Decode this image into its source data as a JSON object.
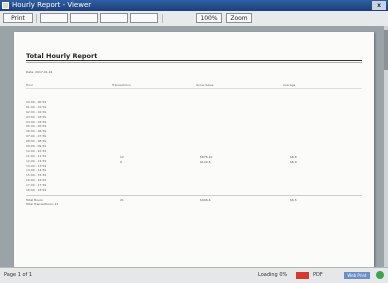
{
  "window": {
    "title": "Hourly Report - Viewer",
    "close_label": "x"
  },
  "toolbar": {
    "buttons": [
      {
        "label": "Print"
      },
      {
        "label": ""
      },
      {
        "label": ""
      },
      {
        "label": ""
      },
      {
        "label": ""
      },
      {
        "label": "100%"
      },
      {
        "label": "Zoom"
      }
    ]
  },
  "report": {
    "title": "Total Hourly Report",
    "subtitle": "Date: 2017-01-01",
    "columns": [
      "Hour",
      "Transactions",
      "Gross Sales",
      "Average"
    ],
    "hours": [
      "00:00 - 00:59",
      "01:00 - 01:59",
      "02:00 - 02:59",
      "03:00 - 03:59",
      "04:00 - 04:59",
      "05:00 - 05:59",
      "06:00 - 06:59",
      "07:00 - 07:59",
      "08:00 - 08:59",
      "09:00 - 09:59",
      "10:00 - 10:59",
      "11:00 - 11:59",
      "12:00 - 12:59",
      "13:00 - 13:59",
      "14:00 - 14:59",
      "15:00 - 15:59",
      "16:00 - 16:59",
      "17:00 - 17:59",
      "18:00 - 18:59"
    ],
    "row_values": {
      "a": {
        "transactions": "12",
        "gross": "$876.10",
        "average": "$6.8"
      },
      "b": {
        "transactions": "9",
        "gross": "$120.5",
        "average": "$6.9"
      }
    },
    "totals_label": "Total Hours",
    "totals_sub": "Total Transactions: 21",
    "totals": {
      "transactions": "21",
      "gross": "$996.6",
      "average": "$6.5"
    }
  },
  "statusbar": {
    "page": "Page 1 of 1",
    "loading": "Loading 0%",
    "mode": "PDF",
    "zoom_label": "Web Print"
  }
}
